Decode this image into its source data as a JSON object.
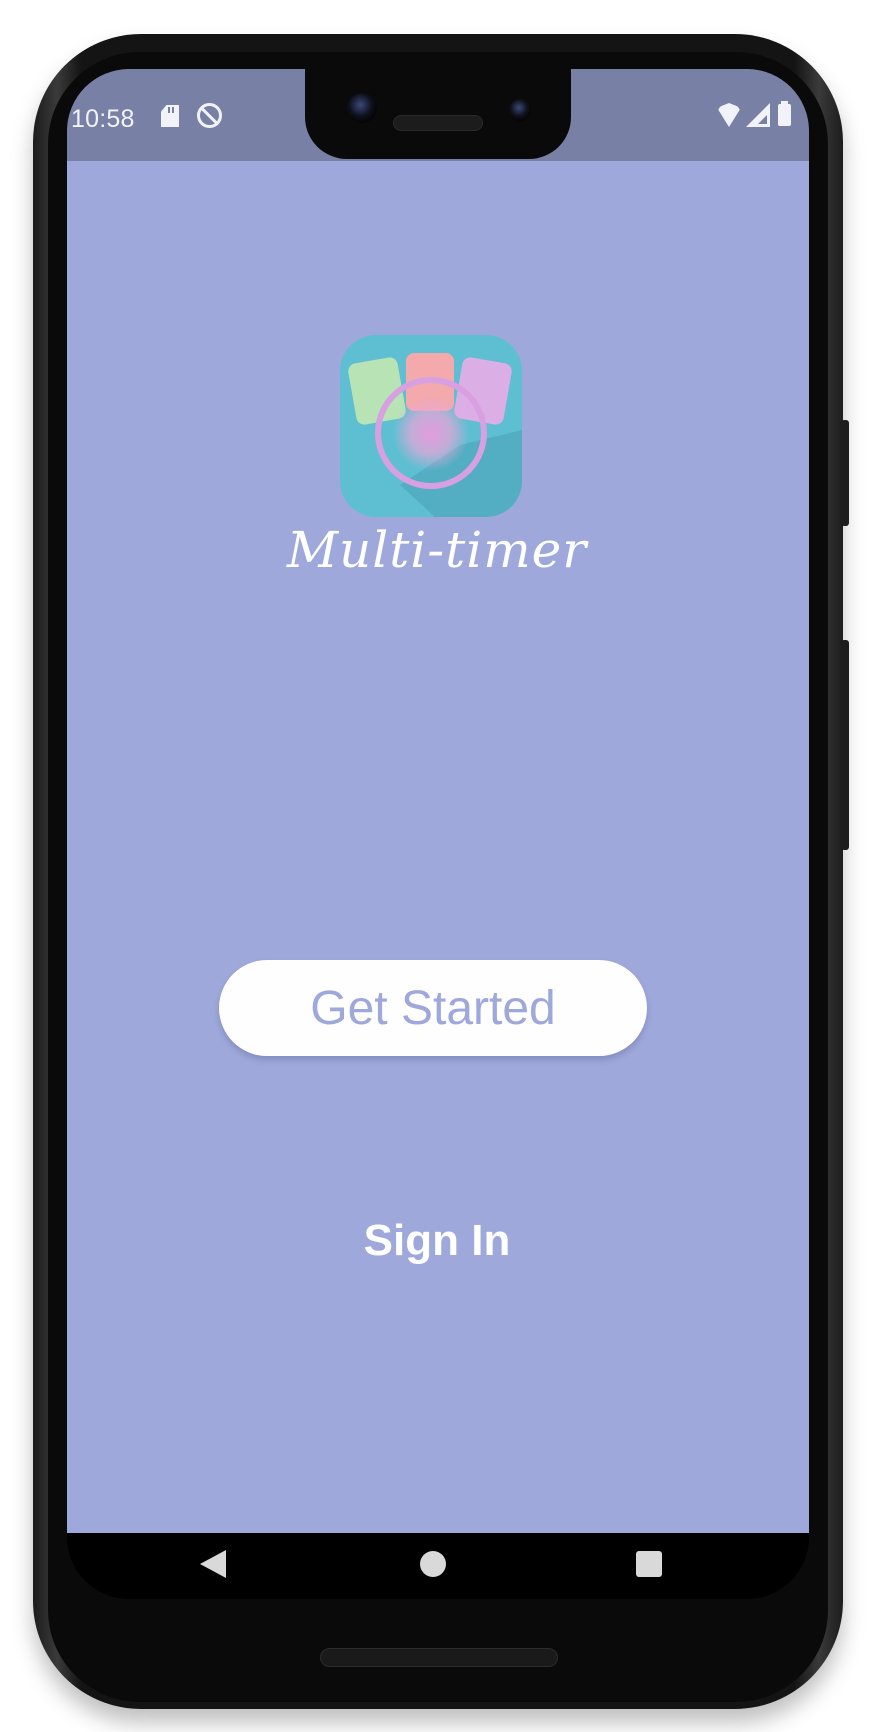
{
  "status_bar": {
    "time": "10:58",
    "icons": [
      "sd-card-icon",
      "do-not-disturb-icon",
      "wifi-icon",
      "signal-icon",
      "battery-icon"
    ]
  },
  "app": {
    "name": "Multi-timer",
    "logo_icon": "multi-timer-app-icon"
  },
  "actions": {
    "get_started_label": "Get Started",
    "sign_in_label": "Sign In"
  },
  "navigation_bar": {
    "buttons": [
      "back-icon",
      "home-icon",
      "recents-icon"
    ]
  },
  "colors": {
    "background": "#9ea8da",
    "status_bar": "#7880a6",
    "button_background": "#fefefe",
    "button_text": "#9ea8da",
    "logo_teal": "#5fbfd2",
    "card_green": "#b7e3b5",
    "card_pink": "#f4a9ac",
    "card_purple": "#dcaee6"
  }
}
